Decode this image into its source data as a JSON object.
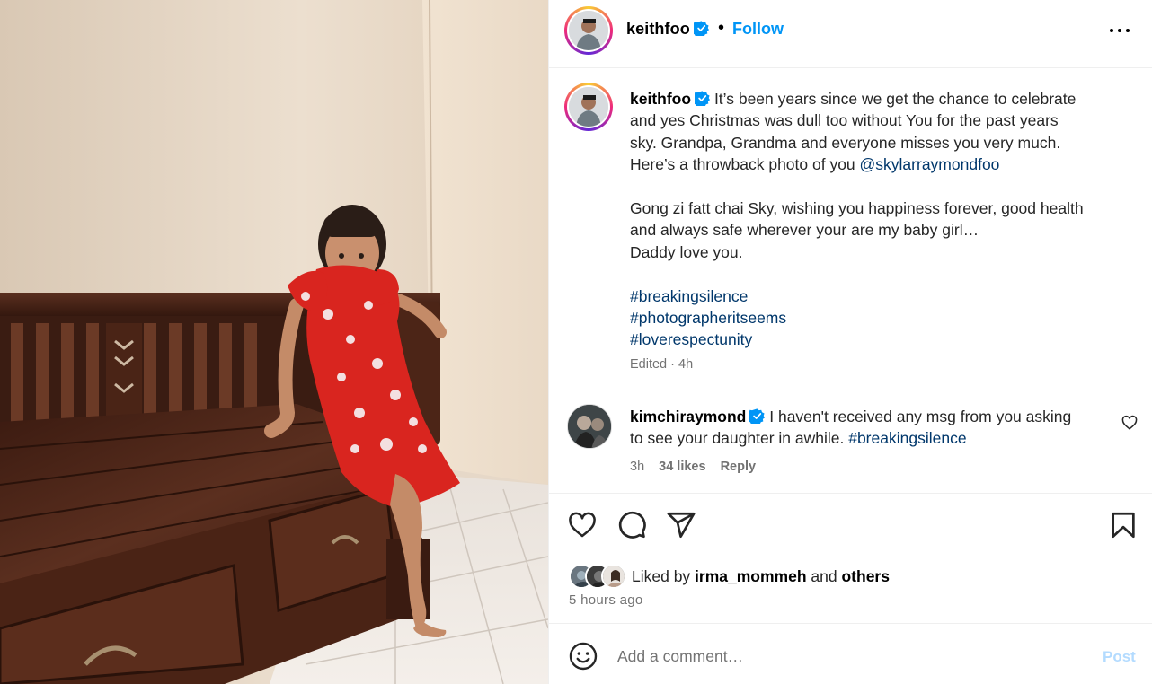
{
  "post": {
    "author": "keithfoo",
    "follow_label": "Follow",
    "separator": "•",
    "caption": {
      "line1": "It’s been years since we get the chance to celebrate",
      "line2": "and yes Christmas was dull too without You for the past years",
      "line3": "sky. Grandpa, Grandma and everyone misses you very much.",
      "line4_prefix": "Here’s a throwback photo of you ",
      "mention": "@skylarraymondfoo",
      "para2_line1": "Gong zi fatt chai Sky, wishing you happiness forever, good health",
      "para2_line2": "and always safe wherever your are my baby girl…",
      "para2_line3": "Daddy love you.",
      "hashtags": [
        "#breakingsilence",
        "#photographeritseems",
        "#loverespectunity"
      ]
    },
    "edited": "Edited · 4h"
  },
  "comment": {
    "author": "kimchiraymond",
    "text_line1": "I haven't received any msg from you asking",
    "text_line2_prefix": "to see your daughter in awhile. ",
    "hashtag": "#breakingsilence",
    "time": "3h",
    "likes": "34 likes",
    "reply_label": "Reply"
  },
  "likes": {
    "prefix": "Liked by ",
    "user": "irma_mommeh",
    "middle": " and ",
    "others": "others"
  },
  "timestamp": "5 hours ago",
  "comment_input": {
    "placeholder": "Add a comment…",
    "post_label": "Post"
  },
  "colors": {
    "accent": "#0095f6",
    "link": "#00376b",
    "muted": "#737373",
    "post_disabled": "#b3dbff",
    "verified": "#0095f6"
  },
  "icons": {
    "like": "heart-icon",
    "comment": "comment-icon",
    "share": "share-icon",
    "save": "bookmark-icon",
    "emoji": "emoji-icon",
    "more": "more-options-icon",
    "verified": "verified-badge-icon"
  }
}
